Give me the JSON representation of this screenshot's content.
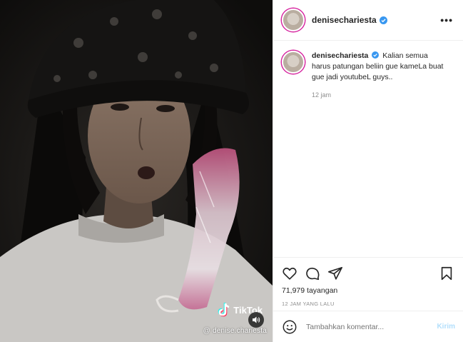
{
  "post": {
    "username": "denisechariesta",
    "caption": "Kalian semua harus patungan beliin gue kameLa buat gue jadi youtubeL guys..",
    "caption_time": "12 jam",
    "views_count": "71,979",
    "views_label": "tayangan",
    "posted_ago": "12 JAM YANG LALU",
    "more_label": "•••"
  },
  "video": {
    "watermark_brand": "TikTok",
    "watermark_handle": "@ denise.chariesta"
  },
  "comment": {
    "placeholder": "Tambahkan komentar...",
    "post_label": "Kirim"
  },
  "colors": {
    "verified": "#3897f0",
    "ring": "#d6249f",
    "post_btn": "#b2dffc",
    "muted_text": "#8e8e8e"
  },
  "icons": [
    "heart-icon",
    "comment-icon",
    "share-icon",
    "bookmark-icon",
    "emoji-icon",
    "verified-badge-icon",
    "volume-icon",
    "tiktok-logo-icon"
  ]
}
